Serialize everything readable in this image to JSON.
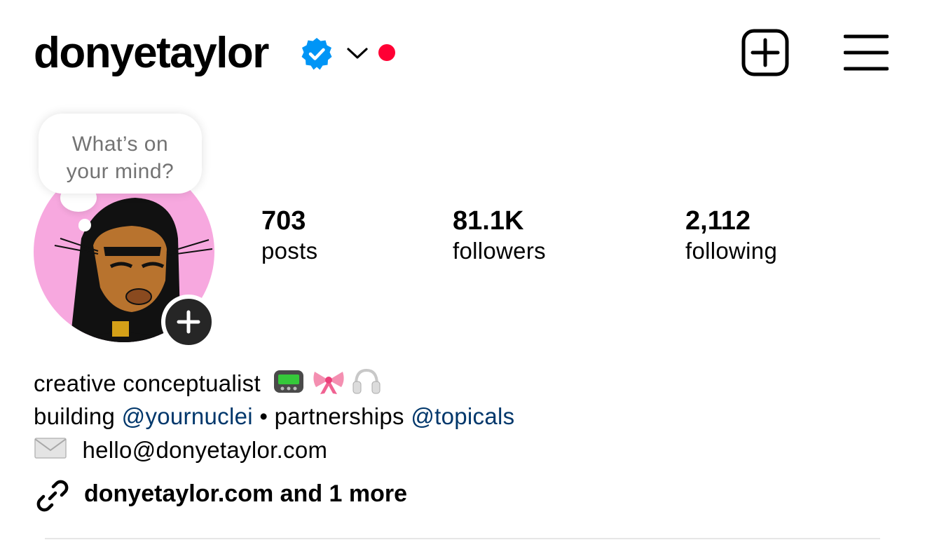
{
  "header": {
    "username": "donyetaylor",
    "verified_icon": "verified-badge-icon",
    "dropdown_icon": "chevron-down-icon",
    "notification_icon": "notification-dot",
    "add_icon": "add-square-icon",
    "menu_icon": "hamburger-menu-icon"
  },
  "note": {
    "line1": "What’s on",
    "line2": "your mind?"
  },
  "stats": [
    {
      "value": "703",
      "label": "posts"
    },
    {
      "value": "81.1K",
      "label": "followers"
    },
    {
      "value": "2,112",
      "label": "following"
    }
  ],
  "bio": {
    "line1": "creative conceptualist",
    "line1_emojis": [
      "pager-icon",
      "pink-bow-icon",
      "headphones-icon"
    ],
    "line2_prefix": "building ",
    "line2_mention1": "@yournuclei",
    "line2_middle": " • partnerships ",
    "line2_mention2": "@topicals",
    "email_icon": "envelope-icon",
    "line3": "hello@donyetaylor.com",
    "link_icon": "link-icon",
    "link_text": "donyetaylor.com and 1 more"
  },
  "colors": {
    "verified_blue": "#0095f6",
    "notification_red": "#ff0034",
    "mention_blue": "#00376b",
    "avatar_bg": "#f7a8df",
    "note_text": "#737373"
  }
}
